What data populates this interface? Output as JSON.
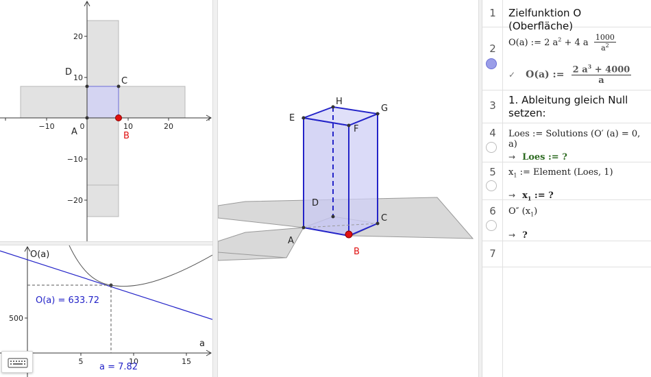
{
  "graphics_top": {
    "x_ticks": [
      "−10",
      "10",
      "20"
    ],
    "y_ticks": [
      "20",
      "10",
      "−10",
      "−20"
    ],
    "origin_label": "0",
    "points": {
      "A": "A",
      "B": "B",
      "C": "C",
      "D": "D"
    }
  },
  "graphics_bottom": {
    "y_axis_label": "O(a)",
    "x_axis_label": "a",
    "x_ticks": [
      "5",
      "10",
      "15"
    ],
    "y_ticks": [
      "500"
    ],
    "value_label": "O(a) = 633.72",
    "a_label": "a = 7.82"
  },
  "graphics_3d": {
    "points": {
      "A": "A",
      "B": "B",
      "C": "C",
      "D": "D",
      "E": "E",
      "F": "F",
      "G": "G",
      "H": "H"
    }
  },
  "algebra": {
    "rows": [
      {
        "num": "1",
        "text": "Zielfunktion O (Oberfläche)"
      },
      {
        "num": "2",
        "def_prefix": "O(a) := 2 a",
        "def_mid": " + 4 a",
        "frac_num": "1000",
        "frac_den": "a",
        "out_lhs": "O(a) :=",
        "out_num_a": "2 a",
        "out_num_b": " + 4000",
        "out_den": "a"
      },
      {
        "num": "3",
        "text": "1. Ableitung gleich Null setzen:"
      },
      {
        "num": "4",
        "input": "Loes := Solutions (O′ (a) = 0, a)",
        "output": "Loes := ?"
      },
      {
        "num": "5",
        "input_a": "x",
        "input_b": " := Element (Loes, 1)",
        "output_a": "x",
        "output_b": " := ?"
      },
      {
        "num": "6",
        "input_a": "O″ (x",
        "input_b": ")",
        "output": "?"
      },
      {
        "num": "7"
      }
    ],
    "arrow": "→",
    "check": "✓",
    "sup2": "2",
    "sup3": "3",
    "sub1": "1"
  },
  "colors": {
    "accent_blue": "#2323c8",
    "point_red": "#e01010",
    "shade_gray": "#e2e2e2",
    "box_fill": "#d6d6f5",
    "output_green": "#2e6b22"
  }
}
